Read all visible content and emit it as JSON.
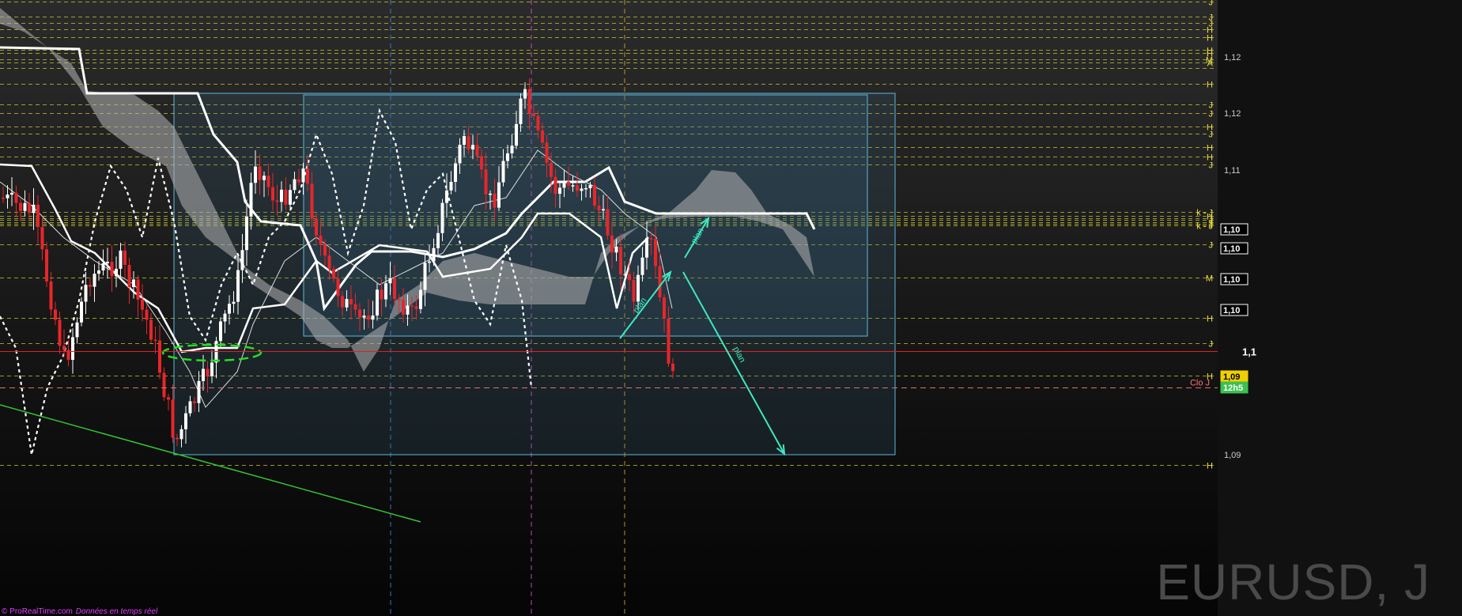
{
  "instrument_label": "EURUSD, J",
  "footer": {
    "brand": "© ProRealTime.com",
    "source": "Données en temps réel"
  },
  "colors": {
    "bullish": "#ffffff",
    "bearish": "#e8262a",
    "level_line": "#c8c832",
    "cloud": "#b4b4b4",
    "box_stroke": "#5fb8d8",
    "box_fill": "#3c6e8c",
    "arrow": "#3ee8c0",
    "trend": "#33c433",
    "ellipse": "#22e022",
    "red_line": "#e02020",
    "close_line": "#e07070",
    "axis_text": "#ffffff",
    "level_text": "#f0e040"
  },
  "chart_data": {
    "type": "candlestick",
    "title": "EURUSD, J",
    "y_axis": {
      "ticks": [
        {
          "value": 1.12,
          "label": "1,12"
        },
        {
          "value": 1.115,
          "label": "1,12"
        },
        {
          "value": 1.11,
          "label": "1,11"
        },
        {
          "value": 1.1,
          "label": "1,1"
        },
        {
          "value": 1.095,
          "label": "1,09"
        }
      ],
      "range": [
        1.09,
        1.13
      ]
    },
    "price_tags": [
      {
        "value": 1.1053,
        "label": "1,10",
        "style": "dark"
      },
      {
        "value": 1.1038,
        "label": "1,10",
        "style": "dark"
      },
      {
        "value": 1.1025,
        "label": "1,10",
        "style": "dark"
      },
      {
        "value": 1.1,
        "label": "1,10",
        "style": "dark"
      },
      {
        "value": 1.0979,
        "label": "1,09",
        "style": "yellow"
      },
      {
        "value": 1.0968,
        "label": "12h5",
        "style": "green"
      }
    ],
    "levels": [
      {
        "value": 1.129,
        "label": "J",
        "dash": "dash"
      },
      {
        "value": 1.1265,
        "label": "J",
        "dash": "dash"
      },
      {
        "value": 1.1255,
        "label": "J",
        "dash": "dash"
      },
      {
        "value": 1.1245,
        "label": "H",
        "dash": "dash"
      },
      {
        "value": 1.1232,
        "label": "H",
        "dash": "dash"
      },
      {
        "value": 1.1212,
        "label": "H",
        "dash": "dash"
      },
      {
        "value": 1.1206,
        "label": "H",
        "dash": "dash"
      },
      {
        "value": 1.1198,
        "label": "M",
        "dash": "dash"
      },
      {
        "value": 1.1195,
        "label": "A",
        "dash": "dash"
      },
      {
        "value": 1.119,
        "label": "",
        "dash": "dash"
      },
      {
        "value": 1.1176,
        "label": "H",
        "dash": "dash"
      },
      {
        "value": 1.1158,
        "label": "J",
        "dash": "dash"
      },
      {
        "value": 1.115,
        "label": "J",
        "dash": "dash"
      },
      {
        "value": 1.1138,
        "label": "H",
        "dash": "dash"
      },
      {
        "value": 1.1132,
        "label": "J",
        "dash": "dash"
      },
      {
        "value": 1.112,
        "label": "H",
        "dash": "dash"
      },
      {
        "value": 1.1112,
        "label": "H",
        "dash": "dash"
      },
      {
        "value": 1.1105,
        "label": "J",
        "dash": "dash"
      },
      {
        "value": 1.1098,
        "label": "k - J",
        "dash": "dash"
      },
      {
        "value": 1.1088,
        "label": "H",
        "dash": "dash"
      },
      {
        "value": 1.1082,
        "label": "J",
        "dash": "dash"
      },
      {
        "value": 1.1077,
        "label": "J",
        "dash": "dash"
      },
      {
        "value": 1.1072,
        "label": "J",
        "dash": "dash"
      },
      {
        "value": 1.1067,
        "label": "J",
        "dash": "dash"
      },
      {
        "value": 1.1063,
        "label": "k - J",
        "dash": "dash"
      },
      {
        "value": 1.1047,
        "label": "J",
        "dash": "dash"
      },
      {
        "value": 1.1034,
        "label": "M",
        "dash": "dash"
      },
      {
        "value": 1.1018,
        "label": "H",
        "dash": "dash"
      },
      {
        "value": 1.1008,
        "label": "J",
        "dash": "dash"
      },
      {
        "value": 1.099,
        "label": "H",
        "dash": "dash"
      },
      {
        "value": 1.0925,
        "label": "H",
        "dash": "dash"
      }
    ],
    "red_line": {
      "value": 1.1005,
      "label": "1,1"
    },
    "close_line": {
      "value": 1.098,
      "label": "Clo J"
    },
    "annotations": [
      {
        "type": "text",
        "text": "plan",
        "position": "on up-arrow near right edge"
      },
      {
        "type": "text",
        "text": "plan",
        "position": "on long down-arrow"
      },
      {
        "type": "text",
        "text": "plan",
        "position": "on lower up-arrow"
      }
    ]
  }
}
